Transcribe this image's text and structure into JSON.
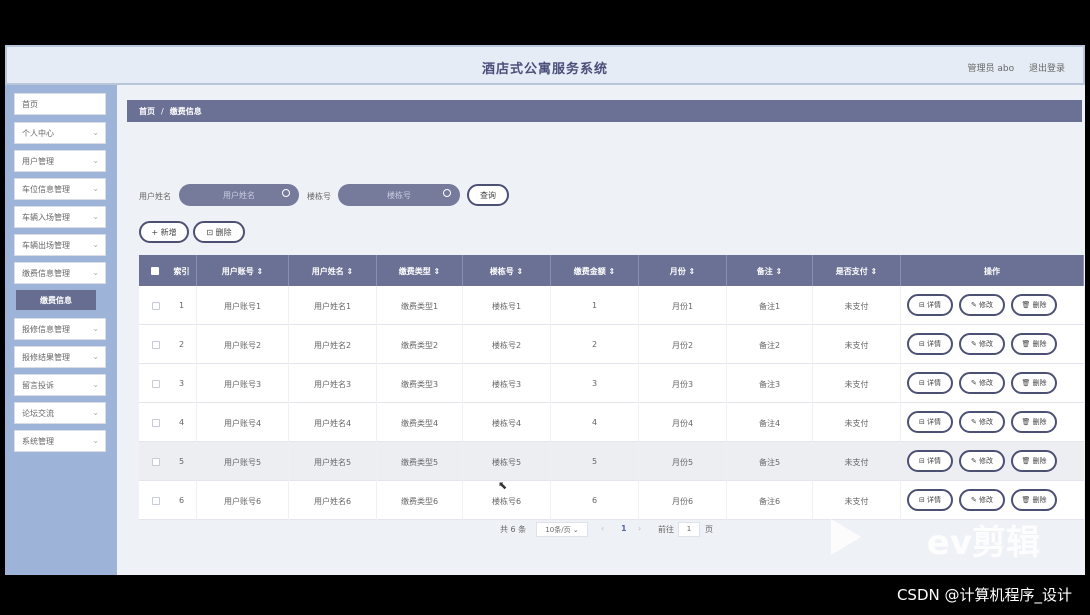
{
  "app": {
    "title": "酒店式公寓服务系统",
    "admin_label": "管理员 abo",
    "logout_label": "退出登录"
  },
  "sidebar": {
    "items": [
      {
        "label": "首页",
        "chevron": false
      },
      {
        "label": "个人中心",
        "chevron": true
      },
      {
        "label": "用户管理",
        "chevron": true
      },
      {
        "label": "车位信息管理",
        "chevron": true
      },
      {
        "label": "车辆入场管理",
        "chevron": true
      },
      {
        "label": "车辆出场管理",
        "chevron": true
      },
      {
        "label": "缴费信息管理",
        "chevron": true
      },
      {
        "label": "报修信息管理",
        "chevron": true
      },
      {
        "label": "报修结果管理",
        "chevron": true
      },
      {
        "label": "留言投诉",
        "chevron": true
      },
      {
        "label": "论坛交流",
        "chevron": true
      },
      {
        "label": "系统管理",
        "chevron": true
      }
    ],
    "active_sub": "缴费信息"
  },
  "breadcrumb": {
    "home": "首页",
    "separator": "/",
    "current": "缴费信息"
  },
  "search": {
    "user_name_label": "用户姓名",
    "user_name_placeholder": "用户姓名",
    "building_label": "楼栋号",
    "building_placeholder": "楼栋号",
    "query_button": "查询"
  },
  "toolbar": {
    "add_label": "+ 新增",
    "delete_label": "删除"
  },
  "table": {
    "headers": [
      "索引",
      "用户账号 ⇕",
      "用户姓名 ⇕",
      "缴费类型 ⇕",
      "楼栋号 ⇕",
      "缴费金额 ⇕",
      "月份 ⇕",
      "备注 ⇕",
      "是否支付 ⇕",
      "操作"
    ],
    "rows": [
      {
        "index": "1",
        "account": "用户账号1",
        "name": "用户姓名1",
        "type": "缴费类型1",
        "building": "楼栋号1",
        "amount": "1",
        "month": "月份1",
        "note": "备注1",
        "paid": "未支付"
      },
      {
        "index": "2",
        "account": "用户账号2",
        "name": "用户姓名2",
        "type": "缴费类型2",
        "building": "楼栋号2",
        "amount": "2",
        "month": "月份2",
        "note": "备注2",
        "paid": "未支付"
      },
      {
        "index": "3",
        "account": "用户账号3",
        "name": "用户姓名3",
        "type": "缴费类型3",
        "building": "楼栋号3",
        "amount": "3",
        "month": "月份3",
        "note": "备注3",
        "paid": "未支付"
      },
      {
        "index": "4",
        "account": "用户账号4",
        "name": "用户姓名4",
        "type": "缴费类型4",
        "building": "楼栋号4",
        "amount": "4",
        "month": "月份4",
        "note": "备注4",
        "paid": "未支付"
      },
      {
        "index": "5",
        "account": "用户账号5",
        "name": "用户姓名5",
        "type": "缴费类型5",
        "building": "楼栋号5",
        "amount": "5",
        "month": "月份5",
        "note": "备注5",
        "paid": "未支付"
      },
      {
        "index": "6",
        "account": "用户账号6",
        "name": "用户姓名6",
        "type": "缴费类型6",
        "building": "楼栋号6",
        "amount": "6",
        "month": "月份6",
        "note": "备注6",
        "paid": "未支付"
      }
    ],
    "actions": {
      "detail": "详情",
      "edit": "修改",
      "delete": "删除"
    }
  },
  "pagination": {
    "total": "共 6 条",
    "page_size": "10条/页",
    "current_page": "1",
    "goto_label": "前往",
    "goto_value": "1",
    "page_suffix": "页"
  },
  "watermark": "ev剪辑",
  "credit": "CSDN @计算机程序_设计",
  "colors": {
    "header_bg": "#6b7194",
    "sidebar_bg": "#9db3d8",
    "pill_bg": "#767b9c"
  }
}
